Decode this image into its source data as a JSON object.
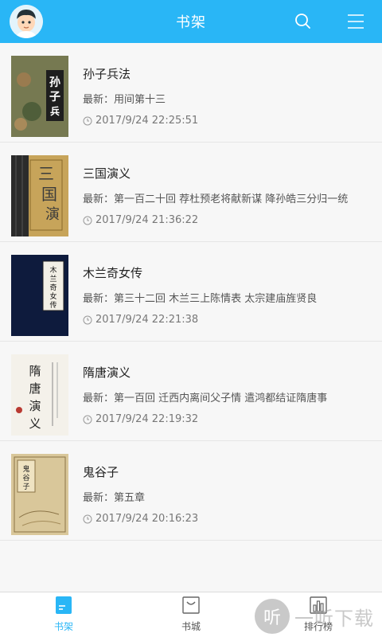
{
  "header": {
    "title": "书架",
    "search_icon": "search-icon",
    "menu_icon": "menu-icon"
  },
  "books": [
    {
      "title": "孙子兵法",
      "latest": "最新：用间第十三",
      "time": "2017/9/24 22:25:51"
    },
    {
      "title": "三国演义",
      "latest": "最新：第一百二十回 荐杜预老将献新谋 降孙皓三分归一统",
      "time": "2017/9/24 21:36:22"
    },
    {
      "title": "木兰奇女传",
      "latest": "最新：第三十二回 木兰三上陈情表 太宗建庙旌贤良",
      "time": "2017/9/24 22:21:38"
    },
    {
      "title": "隋唐演义",
      "latest": "最新：第一百回 迁西内离间父子情 遣鸿都结证隋唐事",
      "time": "2017/9/24 22:19:32"
    },
    {
      "title": "鬼谷子",
      "latest": "最新：第五章",
      "time": "2017/9/24 20:16:23"
    }
  ],
  "tabs": [
    {
      "label": "书架",
      "icon": "bookshelf-icon",
      "active": true
    },
    {
      "label": "书城",
      "icon": "store-bag-icon",
      "active": false
    },
    {
      "label": "排行榜",
      "icon": "ranking-chart-icon",
      "active": false
    }
  ],
  "watermark": {
    "glyph": "听",
    "text": "一听下载"
  },
  "colors": {
    "accent": "#29b6f6"
  }
}
